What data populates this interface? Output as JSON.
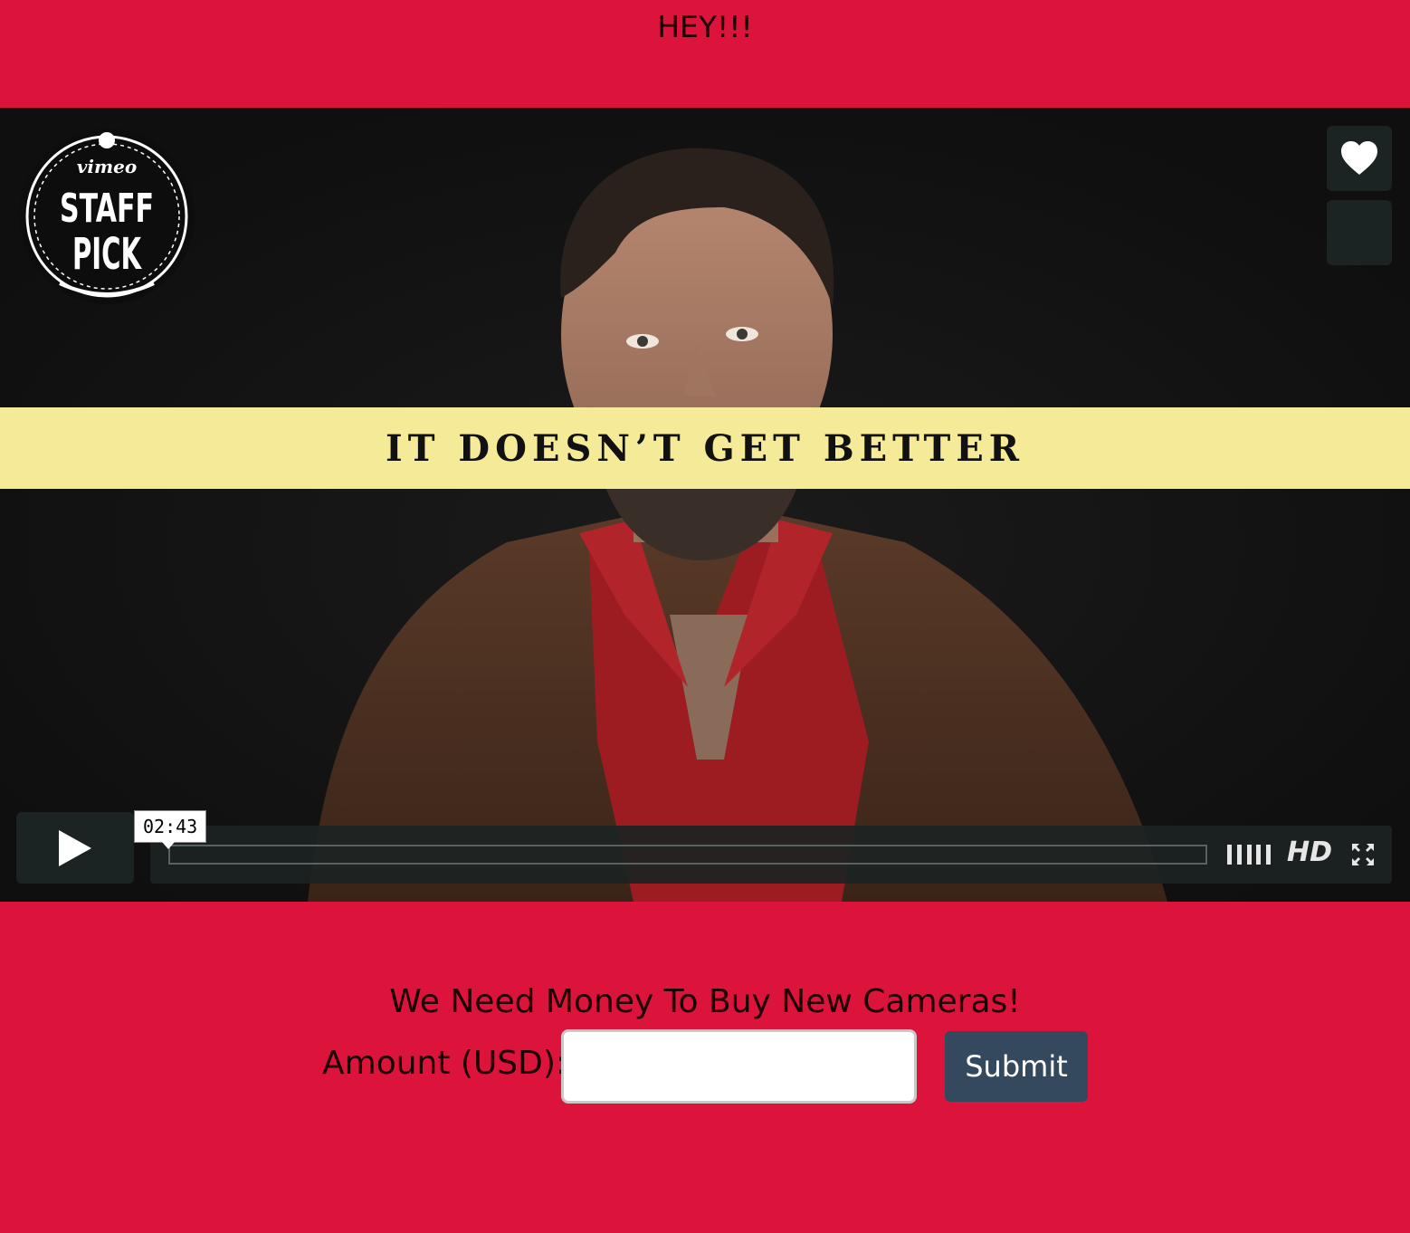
{
  "page": {
    "heading": "HEY!!!"
  },
  "video": {
    "title_card": "IT DOESN’T GET BETTER",
    "badge": {
      "brand": "vimeo",
      "line1": "STAFF",
      "line2": "PICK"
    },
    "controls": {
      "tooltip_time": "02:43",
      "hd_label": "HD",
      "progress_fraction": 0
    },
    "icons": {
      "like": "heart-icon",
      "play": "play-icon",
      "volume": "volume-icon",
      "fullscreen": "fullscreen-icon"
    }
  },
  "donation": {
    "pitch": "We Need Money To Buy New Cameras!",
    "amount_label": "Amount (USD):",
    "amount_value": "",
    "submit_label": "Submit"
  },
  "colors": {
    "page_background": "#dc143c",
    "title_band": "#f4ea98",
    "control_bg": "#1c2323",
    "submit_bg": "#34495e"
  }
}
